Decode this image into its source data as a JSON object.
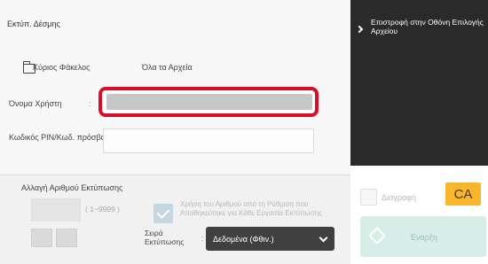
{
  "page": {
    "title": "Εκτύπ. Δέσμης"
  },
  "folder": {
    "label": "Κύριος Φάκελος",
    "value": "Όλα τα Αρχεία"
  },
  "user": {
    "label": "Όνομα Χρήστη",
    "value": "",
    "colon": ":"
  },
  "pin": {
    "label": "Κωδικός PIN/Κωδ. πρόσβασης",
    "value": ""
  },
  "print_count": {
    "title": "Αλλαγή Αριθμού Εκτύπωσης",
    "value": "",
    "range": "( 1~9999 )",
    "use_setting_text": "Χρήση του Αριθμού από τη Ρύθμιση που Αποθηκεύτηκε για Κάθε Εργασία Εκτύπωσης",
    "use_setting_checked": true
  },
  "order": {
    "label": "Σειρά Εκτύπωσης",
    "colon": ":",
    "value": "Δεδομένα (Φθιν.)"
  },
  "sidebar": {
    "return_label": "Επιστροφή στην Οθόνη Επιλογής Αρχείου",
    "delete_label": "Διαγραφή",
    "ca_label": "CA",
    "start_label": "Έναρξη"
  },
  "icons": {
    "folder": "folder-icon",
    "return": "chevron-right-icon",
    "start": "start-diamond-icon",
    "order": "chevron-down-icon"
  },
  "colors": {
    "highlight": "#d80f2a",
    "ca": "#f9b62c",
    "start": "#d6ede8",
    "select": "#404040",
    "return_bg": "#2a2a2a"
  }
}
